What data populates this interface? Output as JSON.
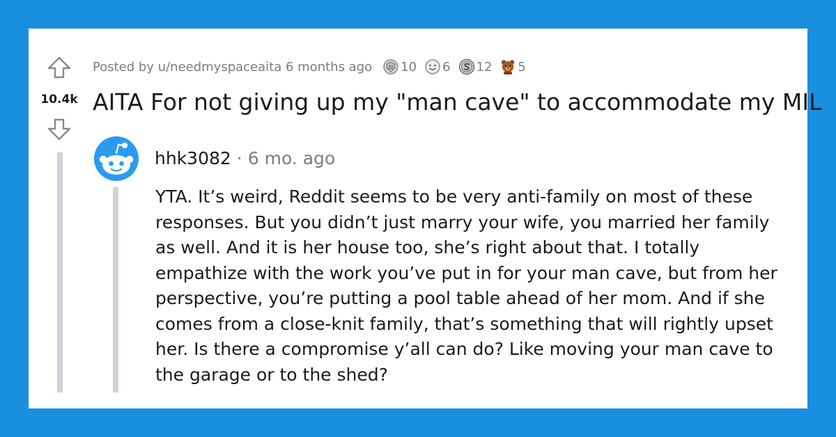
{
  "post": {
    "score": "10.4k",
    "posted_by": "Posted by u/needmyspaceaita 6 months ago",
    "title": "AITA For not giving up my \"man cave\" to accommodate my MIL",
    "awards": [
      {
        "icon": "silver-award-icon",
        "count": "10"
      },
      {
        "icon": "wholesome-award-icon",
        "count": "6"
      },
      {
        "icon": "coin-award-icon",
        "count": "12"
      },
      {
        "icon": "bear-award-icon",
        "count": "5"
      }
    ]
  },
  "comment": {
    "author": "hhk3082",
    "separator": "·",
    "age": "6 mo. ago",
    "body": "YTA. It’s weird, Reddit seems to be very anti-family on most of these responses. But you didn’t just marry your wife, you married her family as well. And it is her house too, she’s right about that. I totally empathize with the work you’ve put in for your man cave, but from her perspective, you’re putting a pool table ahead of her mom. And if she comes from a close-knit family, that’s something that will rightly upset her. Is there a compromise y’all can do? Like moving your man cave to the garage or to the shed?"
  },
  "colors": {
    "background": "#1a8fe0",
    "card": "#ffffff",
    "text": "#1a1a1b",
    "meta": "#7c7c7c",
    "thread_line": "#cfd3da",
    "avatar": "#2a9bf0"
  }
}
